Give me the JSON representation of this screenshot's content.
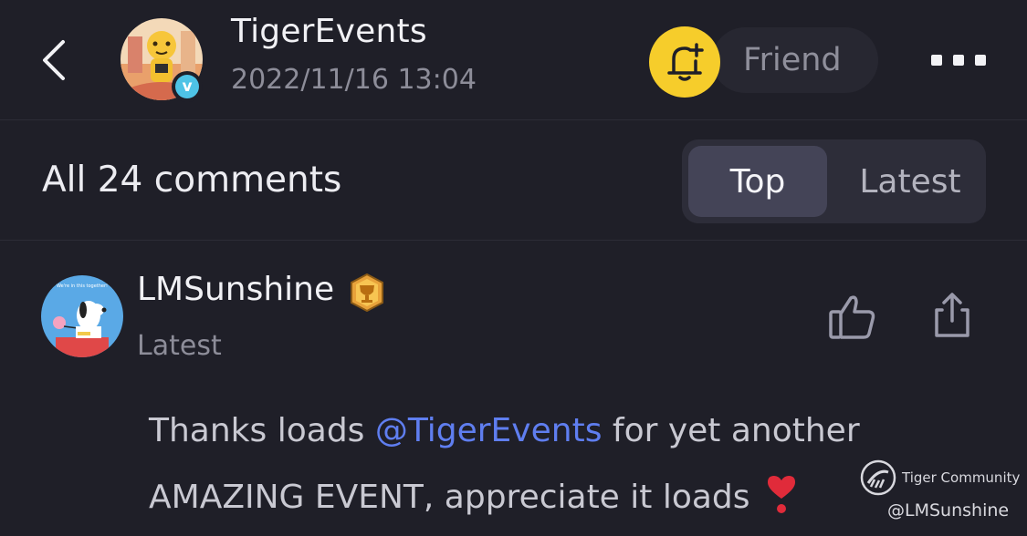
{
  "header": {
    "author_name": "TigerEvents",
    "post_time": "2022/11/16 13:04",
    "verified_badge": "v",
    "friend_label": "Friend",
    "bell_color": "#f6cd2b",
    "back_icon": "chevron-left-icon",
    "more_icon": "more-dots-icon"
  },
  "comments_bar": {
    "count_label": "All 24 comments",
    "sort_tabs": [
      {
        "label": "Top",
        "selected": true
      },
      {
        "label": "Latest",
        "selected": false
      }
    ]
  },
  "comment": {
    "author": "LMSunshine",
    "sort_tag": "Latest",
    "text_before": "Thanks loads ",
    "mention": "@TigerEvents",
    "text_after": " for yet another AMAZING EVENT, appreciate it loads ",
    "emoji": "heavy-heart-exclamation",
    "like_icon": "thumbs-up-icon",
    "share_icon": "share-icon",
    "badge_icon": "trophy-badge-icon",
    "avatar_text": "We're in this together!"
  },
  "watermark": {
    "brand": "Tiger Community",
    "handle": "@LMSunshine"
  },
  "colors": {
    "background": "#1f1f28",
    "accent_yellow": "#f6cd2b",
    "mention_blue": "#5f7ef0",
    "verified_blue": "#4ec3e6"
  }
}
